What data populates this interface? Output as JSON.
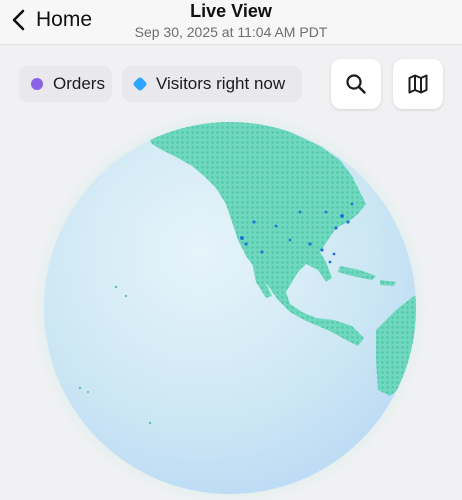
{
  "header": {
    "back_label": "Home",
    "title": "Live View",
    "subtitle": "Sep 30, 2025 at 11:04 AM PDT"
  },
  "legend": {
    "orders": {
      "label": "Orders",
      "color": "#8b63e6"
    },
    "visitors": {
      "label": "Visitors right now",
      "color": "#2ea6ff"
    }
  },
  "toolbar": {
    "search_icon": "search-icon",
    "map_icon": "map-icon"
  },
  "globe": {
    "ocean_color": "#cfe6f3",
    "land_color": "#5cd1b4",
    "visitor_dot_color": "#1e74d6"
  }
}
